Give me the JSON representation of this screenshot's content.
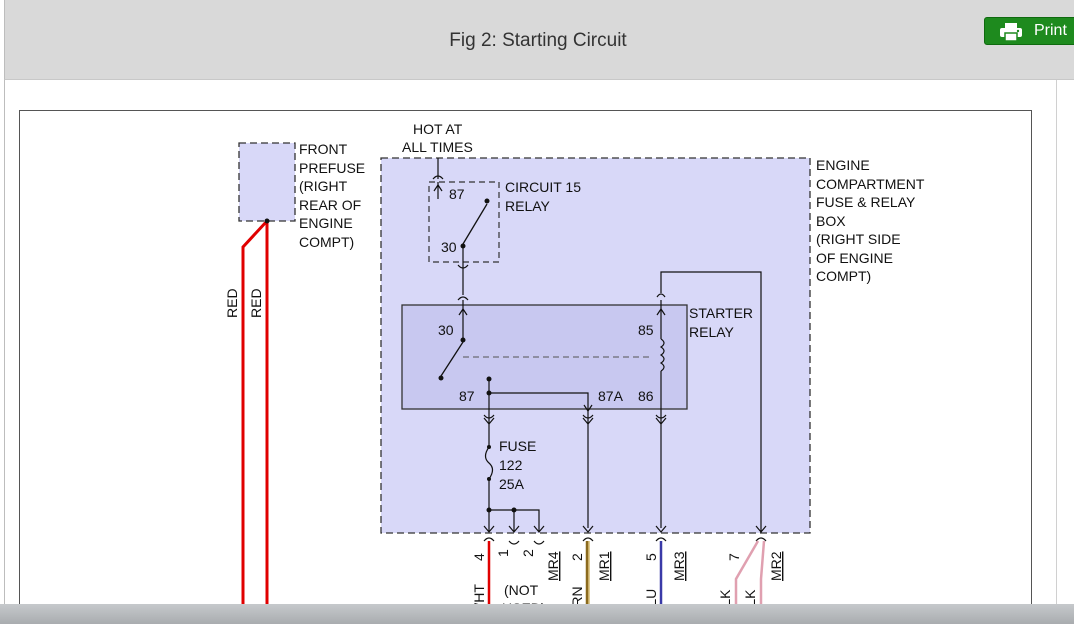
{
  "header": {
    "title": "Fig 2: Starting Circuit"
  },
  "toolbar": {
    "print_label": "Print",
    "print_icon": "printer-icon"
  },
  "diagram": {
    "front_prefuse": [
      "FRONT",
      "PREFUSE",
      "(RIGHT",
      "REAR OF",
      "ENGINE",
      "COMPT)"
    ],
    "hot_at_all_times": [
      "HOT AT",
      "ALL TIMES"
    ],
    "circuit15_relay": [
      "CIRCUIT 15",
      "RELAY"
    ],
    "circuit15_pins": {
      "p87": "87",
      "p30": "30"
    },
    "engine_box": [
      "ENGINE",
      "COMPARTMENT",
      "FUSE & RELAY",
      "BOX",
      "(RIGHT SIDE",
      "OF ENGINE",
      "COMPT)"
    ],
    "starter_relay": [
      "STARTER",
      "RELAY"
    ],
    "starter_pins": {
      "p30": "30",
      "p85": "85",
      "p87": "87",
      "p87a": "87A",
      "p86": "86"
    },
    "fuse": [
      "FUSE",
      "122",
      "25A"
    ],
    "wire_red": "RED",
    "pins": {
      "p4": "4",
      "p1": "1",
      "p2a": "2",
      "p2b": "2",
      "p5": "5",
      "p7": "7"
    },
    "connectors": {
      "mr4": "MR4",
      "mr1": "MR1",
      "mr3": "MR3",
      "mr2": "MR2"
    },
    "wire_labels": {
      "wht": "WHT",
      "brn": "BRN",
      "blu": "BLU",
      "blk1": "BLK",
      "blk2": "BLK"
    },
    "not_used": [
      "(NOT",
      "USED)"
    ],
    "colors": {
      "red_wire": "#e00000",
      "box_fill": "#d8d8f8",
      "relay_fill": "#c8c8f0",
      "print_green": "#1e8a1e"
    }
  }
}
